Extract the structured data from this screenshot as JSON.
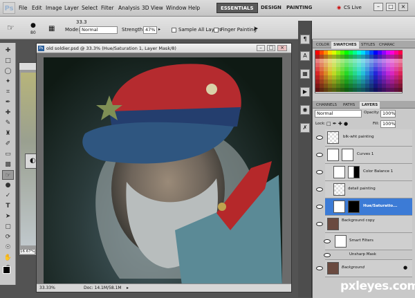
{
  "app": {
    "logo": "Ps",
    "zoom": "33.3"
  },
  "menu": [
    "File",
    "Edit",
    "Image",
    "Layer",
    "Select",
    "Filter",
    "Analysis",
    "3D",
    "View",
    "Window",
    "Help"
  ],
  "workspace": {
    "essentials": "ESSENTIALS",
    "design": "DESIGN",
    "painting": "PAINTING",
    "cs_live": "CS Live"
  },
  "options": {
    "size": "80",
    "mode_label": "Mode:",
    "mode_value": "Normal",
    "strength_label": "Strength:",
    "strength_value": "47%",
    "sample_all_layers": "Sample All Layers",
    "finger_painting": "Finger Painting"
  },
  "document": {
    "title": "old soldier.psd @ 33.3% (Hue/Saturation 1, Layer Mask/8)",
    "zoom_status": "33.33%",
    "doc_info": "Doc: 14.1M/58.1M",
    "bg_zoom": "16.67%"
  },
  "swatches_panel": {
    "tabs": [
      "COLOR",
      "SWATCHES",
      "STYLES",
      "CHARAC"
    ],
    "active": "SWATCHES"
  },
  "layers_panel": {
    "tabs": [
      "CHANNELS",
      "PATHS",
      "LAYERS"
    ],
    "active": "LAYERS",
    "blend_mode": "Normal",
    "opacity_label": "Opacity:",
    "opacity": "100%",
    "lock_label": "Lock:",
    "fill_label": "Fill:",
    "fill": "100%",
    "layers": [
      {
        "name": "blk-wht painting"
      },
      {
        "name": "Curves 1"
      },
      {
        "name": "Color Balance 1"
      },
      {
        "name": "detail painting"
      },
      {
        "name": "Hue/Saturatio..."
      },
      {
        "name": "Background copy"
      },
      {
        "name": "Smart Filters"
      },
      {
        "name": "Unsharp Mask"
      },
      {
        "name": "Background"
      }
    ]
  },
  "watermark": "pxleyes.com",
  "colors": {
    "accent": "#3c7bd6",
    "menu_bg": "#d0d0d0",
    "panel_bg": "#c9c9c9",
    "dark_bg": "#535353"
  }
}
